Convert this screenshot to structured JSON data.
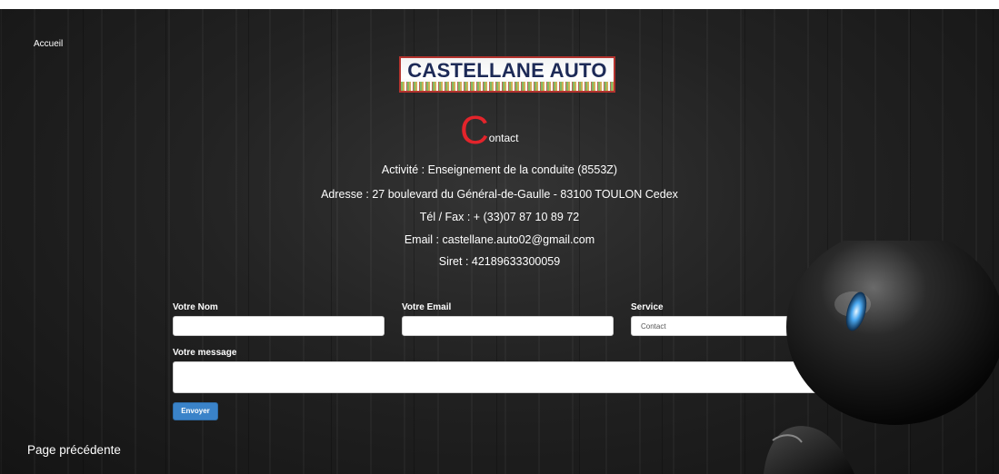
{
  "nav": {
    "home_label": "Accueil",
    "back_label": "Page précédente"
  },
  "logo": {
    "text": "CASTELLANE AUTO"
  },
  "heading": {
    "initial": "C",
    "rest": "ontact"
  },
  "info": {
    "activity": "Activité : Enseignement de la conduite (8553Z)",
    "address": "Adresse : 27 boulevard du Général-de-Gaulle - 83100 TOULON Cedex",
    "phone": "Tél / Fax : + (33)07 87 10 89 72",
    "email": "Email : castellane.auto02@gmail.com",
    "siret": "Siret : 42189633300059"
  },
  "form": {
    "name_label": "Votre Nom",
    "name_value": "",
    "email_label": "Votre Email",
    "email_value": "",
    "service_label": "Service",
    "service_selected": "Contact",
    "message_label": "Votre message",
    "message_value": "",
    "submit_label": "Envoyer"
  },
  "colors": {
    "accent_red": "#e3242b",
    "button_blue": "#3a83c9",
    "background": "#1b1b1b"
  },
  "icons": {
    "select_arrow": "chevron-down-icon"
  }
}
